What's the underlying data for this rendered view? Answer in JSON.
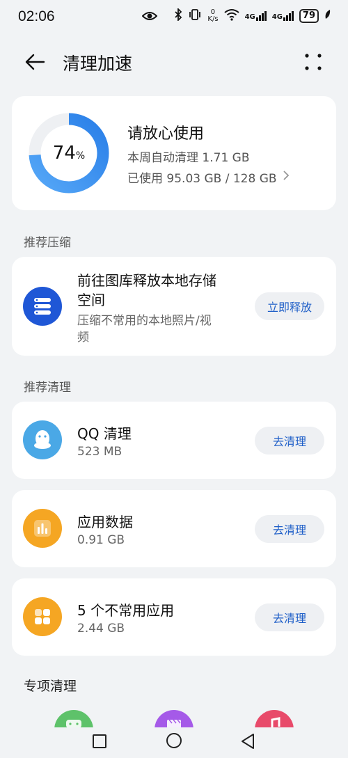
{
  "status": {
    "time": "02:06",
    "net_speed_value": "0",
    "net_speed_unit": "K/s",
    "sig1": "4G",
    "sig2": "4G",
    "battery": "79"
  },
  "header": {
    "title": "清理加速"
  },
  "storage": {
    "percent": "74",
    "percent_sign": "%",
    "percent_value": 0.74,
    "title": "请放心使用",
    "weekly_clean": "本周自动清理 1.71 GB",
    "used": "已使用 95.03 GB / 128 GB"
  },
  "sections": {
    "compress": "推荐压缩",
    "clean": "推荐清理",
    "special": "专项清理"
  },
  "compress_card": {
    "title_line1": "前往图库释放本地存储",
    "title_line2": "空间",
    "sub_line1": "压缩不常用的本地照片/视",
    "sub_line2": "频",
    "button": "立即释放"
  },
  "clean_items": [
    {
      "title": "QQ 清理",
      "sub": "523 MB",
      "button": "去清理"
    },
    {
      "title": "应用数据",
      "sub": "0.91 GB",
      "button": "去清理"
    },
    {
      "title": "5 个不常用应用",
      "sub": "2.44 GB",
      "button": "去清理"
    }
  ],
  "colors": {
    "accent": "#2f86f0",
    "ring_track": "#eef0f3",
    "compress_icon": "#1f57d6",
    "qq_icon": "#4aa8e6",
    "appdata_icon": "#f5a623",
    "unused_icon": "#f5a623",
    "special_green": "#5ec26a",
    "special_purple": "#a55ae8",
    "special_red": "#e84a6a"
  }
}
